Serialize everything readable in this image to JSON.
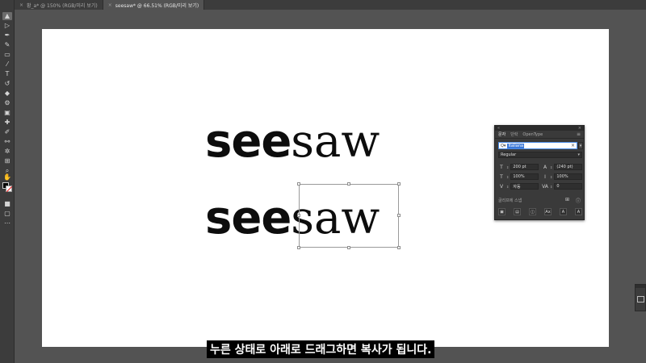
{
  "tabs": [
    {
      "label": "황_a* @ 150% (RGB/미리 보기)",
      "active": false
    },
    {
      "label": "seesaw* @ 66.51% (RGB/미리 보기)",
      "active": true
    }
  ],
  "artboard": {
    "line1": {
      "see": "see",
      "saw": "saw"
    },
    "line2": {
      "see": "see",
      "saw": "saw"
    }
  },
  "character_panel": {
    "tabs": [
      "문자",
      "단락",
      "OpenType"
    ],
    "font_search_prefix": "Q▾",
    "font_name": "Italiana",
    "font_style": "Regular",
    "font_size": "200 pt",
    "leading": "(240 pt)",
    "vertical_scale": "100%",
    "horizontal_scale": "100%",
    "kerning": "자동",
    "tracking": "0",
    "touch_type_label": "글리프에 스냅"
  },
  "subtitle": "누른 상태로 아래로 드래그하면 복사가 됩니다."
}
